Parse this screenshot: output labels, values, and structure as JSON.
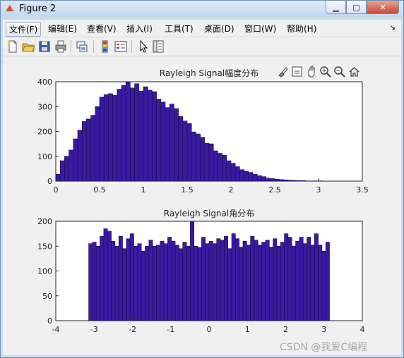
{
  "window": {
    "title": "Figure 2"
  },
  "menu": {
    "items": [
      "文件(F)",
      "编辑(E)",
      "查看(V)",
      "插入(I)",
      "工具(T)",
      "桌面(D)",
      "窗口(W)",
      "帮助(H)"
    ]
  },
  "toolbar": {
    "buttons": [
      "new-figure-icon",
      "open-icon",
      "save-icon",
      "print-icon",
      "link-icon",
      "colorbar-icon",
      "legend-icon",
      "pointer-icon",
      "property-editor-icon"
    ]
  },
  "axes_toolbar": {
    "buttons": [
      "brush-icon",
      "datatip-icon",
      "pan-icon",
      "zoom-in-icon",
      "zoom-out-icon",
      "home-icon"
    ]
  },
  "watermark": "CSDN @我爱C编程",
  "colors": {
    "bar_fill": "#3a1aa0",
    "bar_edge": "#1c0a50",
    "axes_bg": "#ffffff",
    "figure_bg": "#f0f0f0"
  },
  "chart_data": [
    {
      "type": "bar",
      "title": "Rayleigh Signal幅度分布",
      "xlim": [
        0,
        3.5
      ],
      "ylim": [
        0,
        400
      ],
      "xticks": [
        "0",
        "0.5",
        "1",
        "1.5",
        "2",
        "2.5",
        "3",
        "3.5"
      ],
      "yticks": [
        "0",
        "100",
        "200",
        "300",
        "400"
      ],
      "bin_start": 0.0,
      "bin_width": 0.05,
      "values": [
        28,
        82,
        100,
        125,
        170,
        205,
        240,
        250,
        265,
        300,
        338,
        348,
        352,
        345,
        370,
        385,
        398,
        375,
        392,
        362,
        380,
        366,
        360,
        330,
        318,
        296,
        310,
        292,
        260,
        242,
        232,
        198,
        190,
        176,
        152,
        150,
        122,
        112,
        104,
        82,
        72,
        58,
        46,
        40,
        35,
        28,
        22,
        18,
        12,
        10,
        8,
        6,
        5,
        4,
        3,
        2,
        2,
        1,
        1,
        1,
        1,
        0,
        0
      ]
    },
    {
      "type": "bar",
      "title": "Rayleigh Signal角分布",
      "xlim": [
        -4,
        4
      ],
      "ylim": [
        0,
        200
      ],
      "xticks": [
        "-4",
        "-3",
        "-2",
        "-1",
        "0",
        "1",
        "2",
        "3",
        "4"
      ],
      "yticks": [
        "0",
        "50",
        "100",
        "150",
        "200"
      ],
      "bin_start": -3.1416,
      "bin_width": 0.0982,
      "values": [
        155,
        158,
        150,
        170,
        185,
        180,
        160,
        150,
        170,
        145,
        165,
        175,
        150,
        155,
        140,
        150,
        162,
        150,
        152,
        160,
        155,
        168,
        160,
        152,
        145,
        158,
        150,
        200,
        150,
        147,
        168,
        155,
        160,
        155,
        165,
        162,
        170,
        145,
        175,
        165,
        148,
        160,
        152,
        170,
        162,
        152,
        158,
        162,
        148,
        165,
        150,
        158,
        175,
        168,
        150,
        160,
        168,
        155,
        168,
        152,
        175,
        152,
        140,
        158
      ]
    }
  ]
}
